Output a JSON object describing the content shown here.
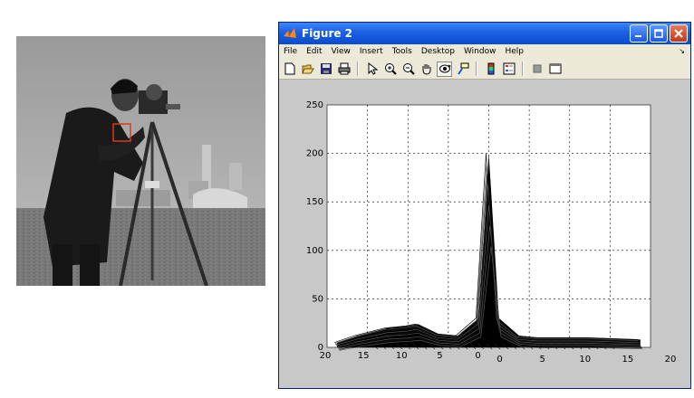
{
  "figure": {
    "title": "Figure 2",
    "menu": [
      "File",
      "Edit",
      "View",
      "Insert",
      "Tools",
      "Desktop",
      "Window",
      "Help"
    ],
    "toolbar_icons": [
      "new-figure-icon",
      "open-file-icon",
      "save-icon",
      "print-icon",
      "edit-plot-arrow-icon",
      "zoom-in-icon",
      "zoom-out-icon",
      "pan-hand-icon",
      "rotate-3d-icon",
      "data-cursor-icon",
      "colorbar-icon",
      "legend-icon",
      "hide-plot-tools-icon",
      "show-plot-tools-icon"
    ],
    "pressed_tool": "rotate-3d-icon",
    "title_bar_color": "#0a4bd0"
  },
  "chart_data": {
    "type": "area",
    "projection": "3d-mesh",
    "title": "",
    "xlabel": "",
    "ylabel": "",
    "zlim": [
      0,
      250
    ],
    "z_ticks": [
      "0",
      "50",
      "100",
      "150",
      "200",
      "250"
    ],
    "x_ticks_left": [
      "20",
      "15",
      "10",
      "5",
      "0"
    ],
    "x_ticks_right": [
      "0",
      "5",
      "10",
      "15",
      "20"
    ],
    "grid": true,
    "series": [
      {
        "values": [
          [
            -15,
            5
          ],
          [
            -13,
            12
          ],
          [
            -10,
            20
          ],
          [
            -8,
            22
          ],
          [
            -7,
            24
          ],
          [
            -5,
            14
          ],
          [
            -3,
            12
          ],
          [
            -1,
            30
          ],
          [
            0,
            200
          ],
          [
            1,
            30
          ],
          [
            3,
            12
          ],
          [
            5,
            10
          ],
          [
            10,
            10
          ],
          [
            15,
            8
          ]
        ]
      }
    ]
  }
}
